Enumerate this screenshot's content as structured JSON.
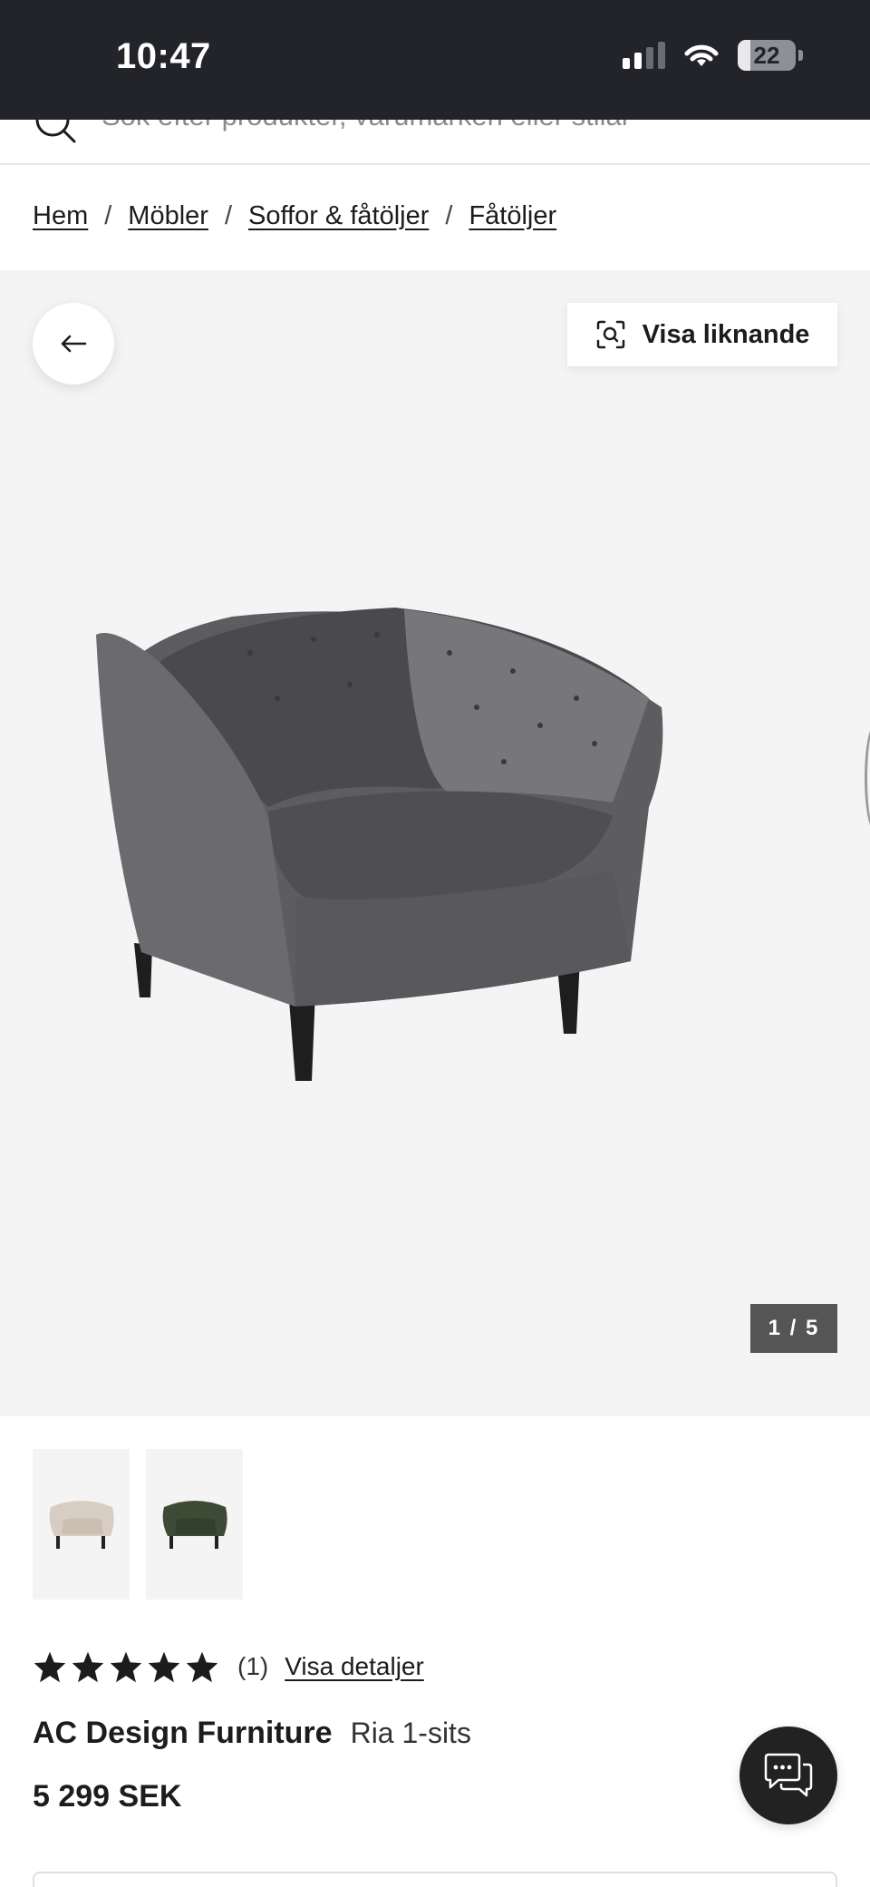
{
  "status_bar": {
    "time": "10:47",
    "battery": "22"
  },
  "search": {
    "placeholder": "Sök efter produkter, varumärken eller stilar"
  },
  "breadcrumb": [
    "Hem",
    "Möbler",
    "Soffor & fåtöljer",
    "Fåtöljer"
  ],
  "gallery": {
    "similar_label": "Visa liknande",
    "counter": "1 / 5",
    "main_image_color": "#5b5a5e",
    "thumbnails": [
      {
        "name": "beige-chair-thumbnail",
        "color": "#d8cdc2"
      },
      {
        "name": "green-chair-thumbnail",
        "color": "#3d4a36"
      }
    ]
  },
  "product": {
    "rating_stars": 5,
    "review_count": "(1)",
    "details_link": "Visa detaljer",
    "brand": "AC Design Furniture",
    "name": "Ria 1-sits",
    "price": "5 299 SEK"
  },
  "colors": {
    "accent": "#22242a",
    "background_gallery": "#f4f4f4"
  }
}
